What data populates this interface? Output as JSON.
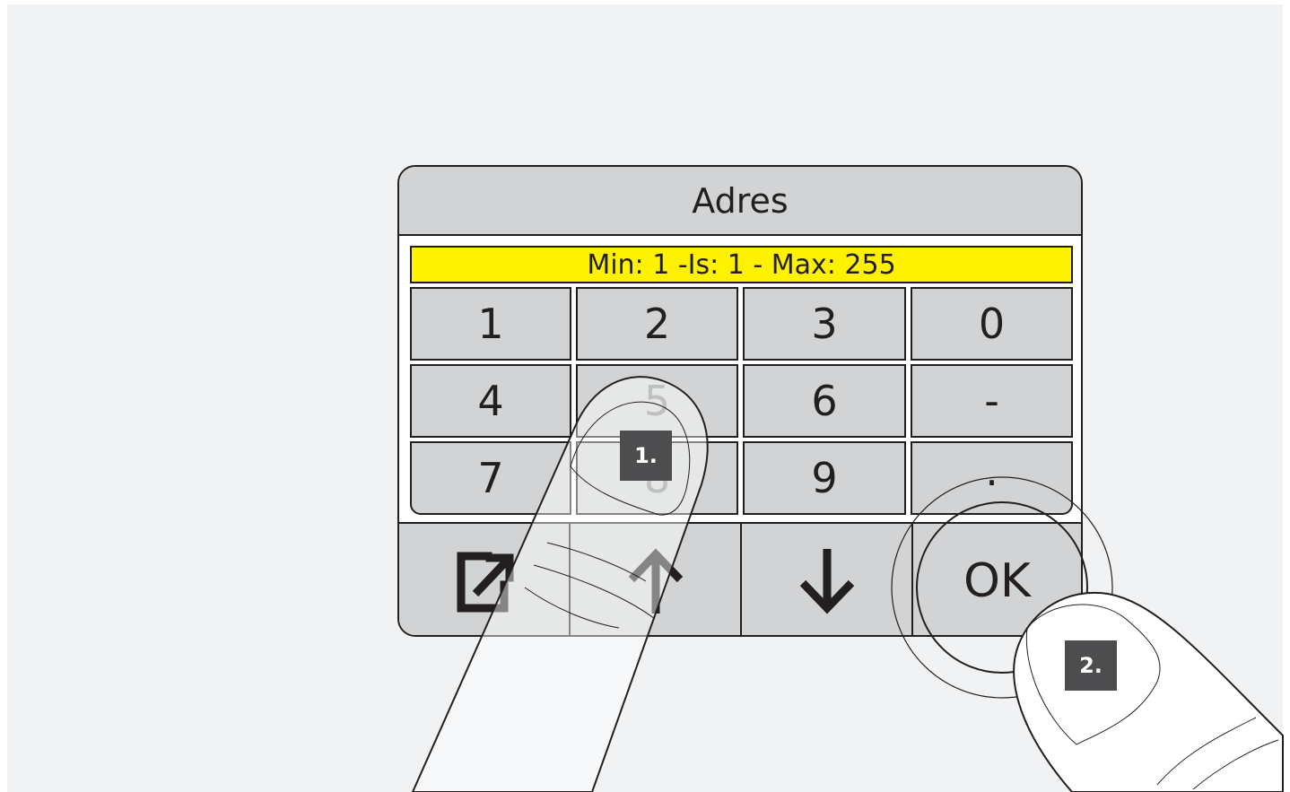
{
  "dialog": {
    "title": "Adres",
    "range_text": "Min: 1 -Is: 1 - Max: 255"
  },
  "keypad": {
    "keys": [
      "1",
      "2",
      "3",
      "0",
      "4",
      "5",
      "6",
      "-",
      "7",
      "8",
      "9",
      "."
    ]
  },
  "actions": {
    "ok_label": "OK",
    "icons": [
      "external-edit-icon",
      "arrow-up-icon",
      "arrow-down-icon",
      "ok-button"
    ]
  },
  "steps": {
    "step1": "1.",
    "step2": "2."
  },
  "colors": {
    "range_highlight": "#fff200",
    "panel_gray": "#d2d3d4",
    "badge_gray": "#4d4d4f"
  }
}
